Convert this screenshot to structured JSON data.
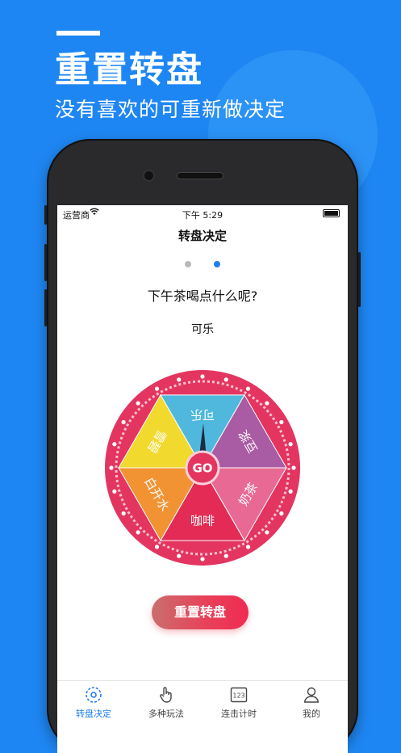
{
  "promo": {
    "headline": "重置转盘",
    "subline": "没有喜欢的可重新做决定"
  },
  "status_bar": {
    "carrier": "运营商",
    "time": "下午 5:29"
  },
  "nav": {
    "title": "转盘决定"
  },
  "pager": {
    "count": 2,
    "active_index": 1
  },
  "question": "下午茶喝点什么呢?",
  "result": "可乐",
  "wheel": {
    "center_label": "GO",
    "segments": [
      {
        "label": "可乐",
        "color": "#4fb8dc"
      },
      {
        "label": "豆浆",
        "color": "#a95ba3"
      },
      {
        "label": "奶茶",
        "color": "#e86a94"
      },
      {
        "label": "咖啡",
        "color": "#e32b55"
      },
      {
        "label": "白开水",
        "color": "#f29333"
      },
      {
        "label": "雪碧",
        "color": "#f1d92e"
      }
    ]
  },
  "reset_button": "重置转盘",
  "tabs": [
    {
      "label": "转盘决定",
      "icon": "wheel-icon",
      "active": true
    },
    {
      "label": "多种玩法",
      "icon": "hand-pointer-icon",
      "active": false
    },
    {
      "label": "连击计时",
      "icon": "counter-123-icon",
      "active": false
    },
    {
      "label": "我的",
      "icon": "user-icon",
      "active": false
    }
  ],
  "colors": {
    "background": "#1e86f2",
    "accent": "#1e7ff0",
    "wheel_rim": "#e33560",
    "tab_inactive": "#444444"
  }
}
